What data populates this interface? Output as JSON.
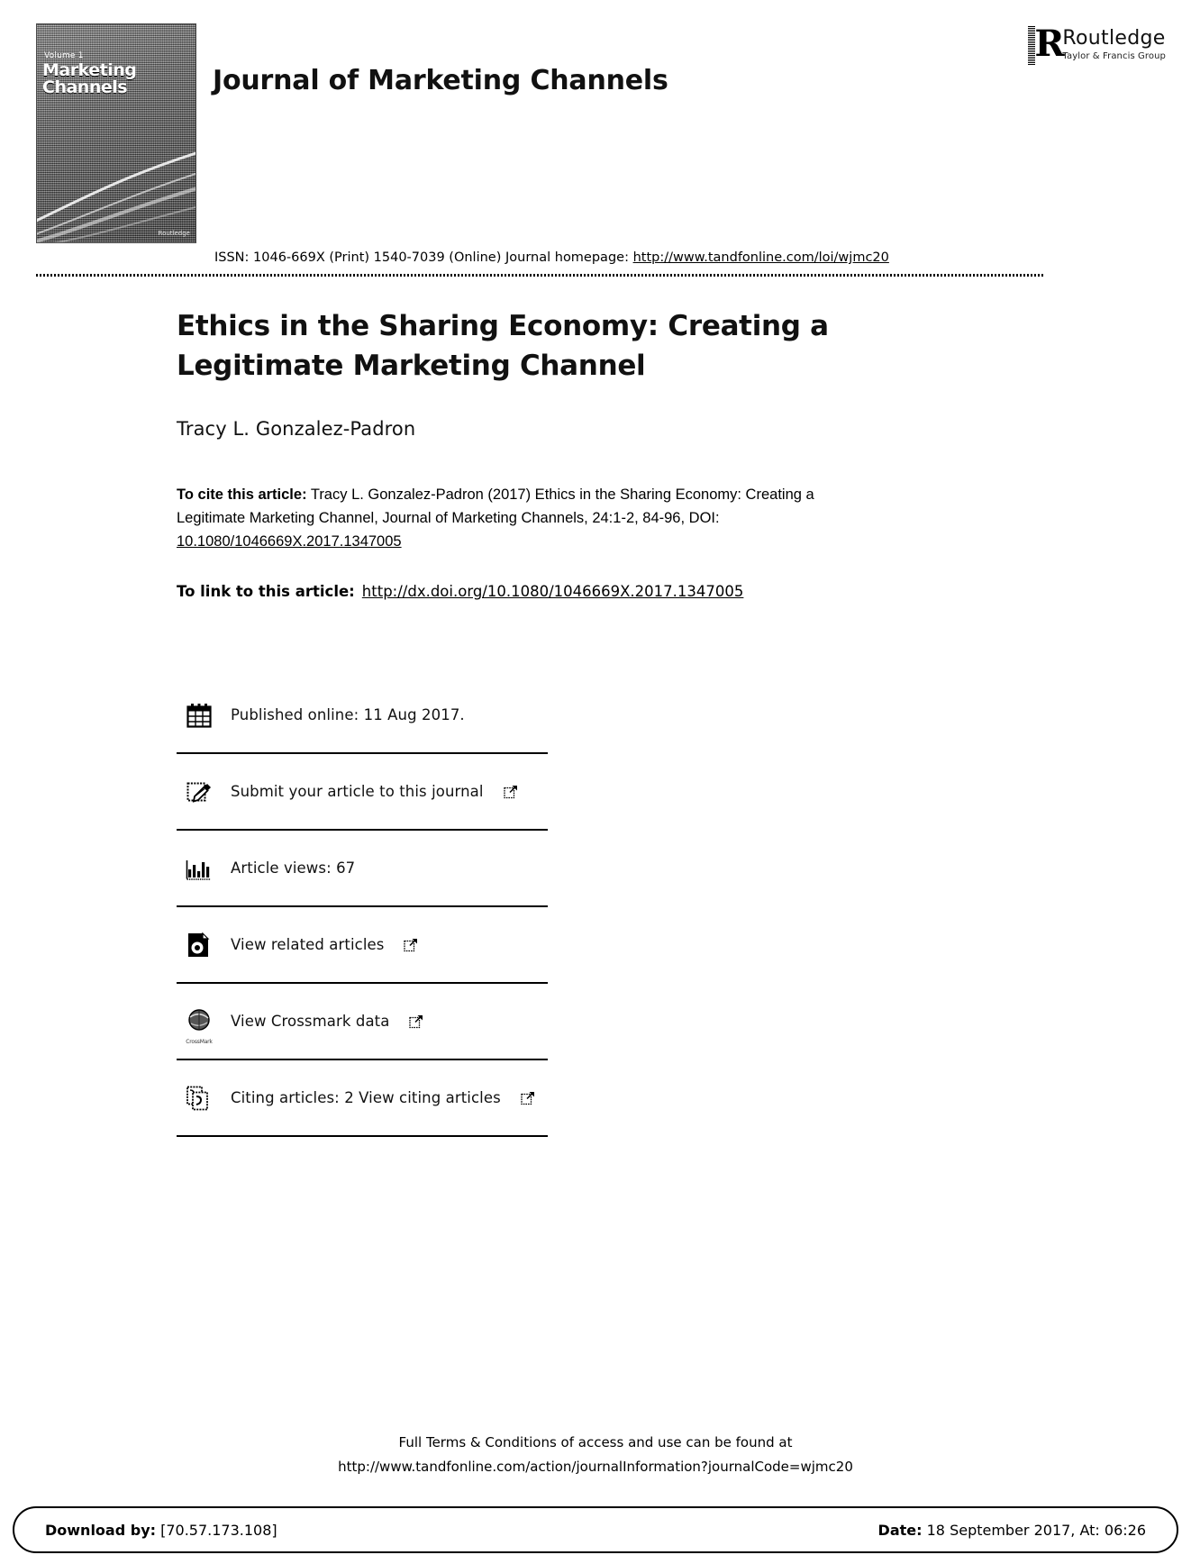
{
  "header": {
    "journal_title": "Journal of Marketing Channels",
    "cover": {
      "top_label": "Volume 1",
      "title_line1": "Marketing",
      "title_line2": "Channels",
      "corner_label": "Routledge"
    },
    "publisher": {
      "name": "Routledge",
      "group": "Taylor & Francis Group"
    },
    "issn": {
      "prefix": "ISSN: 1046-669X (Print) 1540-7039 (Online) Journal homepage: ",
      "homepage_url": "http://www.tandfonline.com/loi/wjmc20"
    }
  },
  "article": {
    "title": "Ethics in the Sharing Economy: Creating a Legitimate Marketing Channel",
    "author": "Tracy L. Gonzalez-Padron",
    "citation": {
      "label": "To cite this article:",
      "text": " Tracy L. Gonzalez-Padron (2017) Ethics in the Sharing Economy: Creating a Legitimate Marketing Channel, Journal of Marketing Channels, 24:1-2, 84-96, DOI:",
      "doi": "10.1080/1046669X.2017.1347005"
    },
    "link": {
      "label": "To link to this article:",
      "url": "http://dx.doi.org/10.1080/1046669X.2017.1347005"
    }
  },
  "actions": [
    {
      "icon": "calendar-icon",
      "label": "Published online: 11 Aug 2017.",
      "external": false
    },
    {
      "icon": "submit-article-icon",
      "label": "Submit your article to this journal",
      "external": true
    },
    {
      "icon": "article-views-icon",
      "label": "Article views: 67",
      "external": false
    },
    {
      "icon": "related-articles-icon",
      "label": "View related articles",
      "external": true
    },
    {
      "icon": "crossmark-icon",
      "label": "View Crossmark data",
      "external": true,
      "caption": "CrossMark"
    },
    {
      "icon": "citing-articles-icon",
      "label": "Citing articles: 2 View citing articles",
      "external": true
    }
  ],
  "footer": {
    "terms_line1": "Full Terms & Conditions of access and use can be found at",
    "terms_line2": "http://www.tandfonline.com/action/journalInformation?journalCode=wjmc20",
    "download_label": "Download by:",
    "download_value": " [70.57.173.108]",
    "date_label": "Date:",
    "date_value": " 18 September 2017, At: 06:26"
  }
}
